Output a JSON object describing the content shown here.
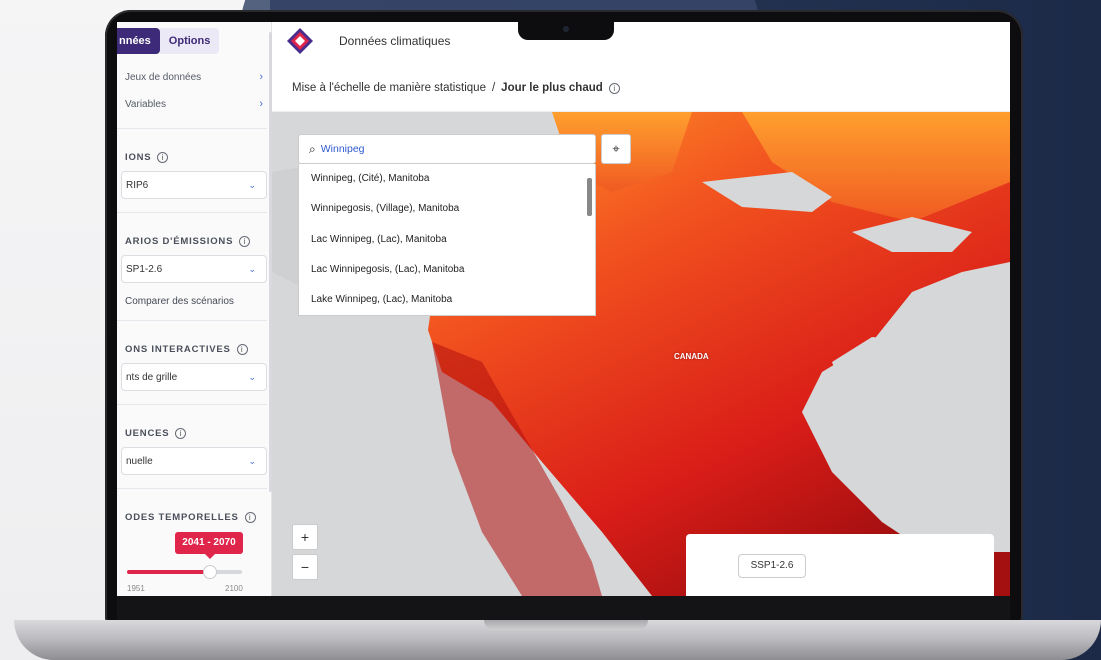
{
  "sidebar": {
    "tabs": [
      {
        "label": "nnées"
      },
      {
        "label": "Options"
      }
    ],
    "nav_items": [
      {
        "label": "Jeux de données"
      },
      {
        "label": "Variables"
      }
    ],
    "sections": [
      {
        "label": "IONS",
        "value": "RIP6"
      },
      {
        "label": "ARIOS D'ÉMISSIONS",
        "value": "SP1-2.6"
      },
      {
        "label": "ONS INTERACTIVES",
        "value": "nts de grille"
      },
      {
        "label": "UENCES",
        "value": "nuelle"
      },
      {
        "label": "ODES TEMPORELLES"
      }
    ],
    "compare_label": "Comparer des scénarios",
    "period": {
      "range_label": "2041 - 2070",
      "tick_left": "1951",
      "tick_right": "2100",
      "progress": 0.72
    }
  },
  "header": {
    "app_title": "Données climatiques",
    "breadcrumb": {
      "parent": "Mise à l'échelle de manière statistique",
      "separator": "/",
      "current": "Jour le plus chaud"
    }
  },
  "map": {
    "search": {
      "value": "Winnipeg"
    },
    "suggestions": [
      "Winnipeg, (Cité), Manitoba",
      "Winnipegosis, (Village), Manitoba",
      "Lac Winnipeg, (Lac), Manitoba",
      "Lac Winnipegosis, (Lac), Manitoba",
      "Lake Winnipeg, (Lac), Manitoba"
    ],
    "zoom_in": "+",
    "zoom_out": "−",
    "country_label": "CANADA",
    "scenario_chip": "SSP1-2.6"
  },
  "icons": {
    "info": "info-icon",
    "search": "search-icon",
    "locate": "crosshair-icon",
    "chevron_right": "chevron-right-icon",
    "chevron_down": "chevron-down-icon"
  },
  "colors": {
    "brand_purple": "#3d2a78",
    "accent_red": "#e0254a",
    "link_blue": "#4a6fd8"
  }
}
